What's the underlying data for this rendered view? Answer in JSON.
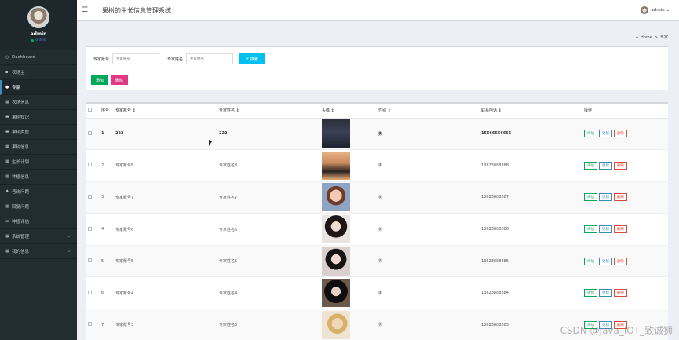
{
  "sidebar": {
    "user": {
      "name": "admin",
      "status": "online"
    },
    "items": [
      {
        "label": "Dashboard",
        "icon": "○",
        "active": false
      },
      {
        "label": "农场主",
        "icon": "▪",
        "active": false
      },
      {
        "label": "专家",
        "icon": "●",
        "active": true
      },
      {
        "label": "农场信息",
        "icon": "▦",
        "active": false
      },
      {
        "label": "果树知识",
        "icon": "▬",
        "active": false
      },
      {
        "label": "果树类型",
        "icon": "▬",
        "active": false
      },
      {
        "label": "果树信息",
        "icon": "▦",
        "active": false
      },
      {
        "label": "生长计划",
        "icon": "▦",
        "active": false
      },
      {
        "label": "种植信息",
        "icon": "▦",
        "active": false
      },
      {
        "label": "咨询问题",
        "icon": "♦",
        "active": false
      },
      {
        "label": "回复问题",
        "icon": "▦",
        "active": false
      },
      {
        "label": "种植评估",
        "icon": "▬",
        "active": false
      },
      {
        "label": "系统管理",
        "icon": "▦",
        "active": false,
        "chevron": "⌵"
      },
      {
        "label": "我的信息",
        "icon": "▦",
        "active": false,
        "chevron": "⌵"
      }
    ]
  },
  "header": {
    "menu_icon": "☰",
    "title": "果树的生长信息管理系统",
    "user": "admin ⌄"
  },
  "breadcrumb": {
    "home": "Home",
    "sep": ">",
    "current": "专家"
  },
  "search": {
    "label1": "专家账号",
    "placeholder1": "专家账号",
    "label2": "专家姓名",
    "placeholder2": "专家姓名",
    "button": "搜索"
  },
  "actions": {
    "add": "添加",
    "delete": "删除"
  },
  "table": {
    "headers": [
      "序号",
      "专家账号 ⇕",
      "专家姓名 ⇕",
      "头像 ⇕",
      "性别 ⇕",
      "联系电话 ⇕",
      "操作"
    ],
    "row_actions": {
      "eval": "评估",
      "update": "更新",
      "delete": "删除"
    },
    "rows": [
      {
        "no": "1",
        "account": "222",
        "name": "222",
        "gender": "男",
        "phone": "15666666666"
      },
      {
        "no": "2",
        "account": "专家账号8",
        "name": "专家姓名8",
        "gender": "男",
        "phone": "13823888888"
      },
      {
        "no": "3",
        "account": "专家账号7",
        "name": "专家姓名7",
        "gender": "男",
        "phone": "13823888887"
      },
      {
        "no": "4",
        "account": "专家账号6",
        "name": "专家姓名6",
        "gender": "男",
        "phone": "13823888886"
      },
      {
        "no": "5",
        "account": "专家账号5",
        "name": "专家姓名5",
        "gender": "男",
        "phone": "13823888885"
      },
      {
        "no": "6",
        "account": "专家账号4",
        "name": "专家姓名4",
        "gender": "男",
        "phone": "13823888884"
      },
      {
        "no": "7",
        "account": "专家账号3",
        "name": "专家姓名3",
        "gender": "男",
        "phone": "13823888883"
      }
    ]
  },
  "watermark": "CSDN @Java_lOT_致诚狮",
  "colors": {
    "sidebar": "#222d32",
    "accent": "#3c8dbc",
    "search": "#00c0ef",
    "add": "#00a65a",
    "delete": "#e03a84"
  }
}
